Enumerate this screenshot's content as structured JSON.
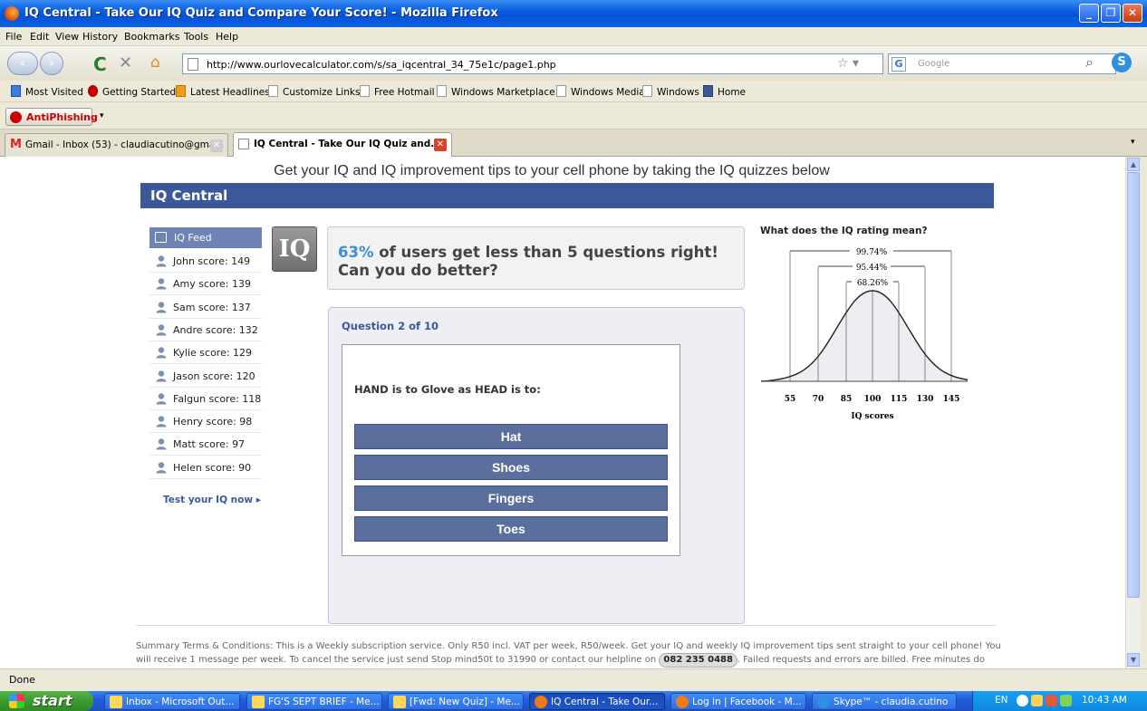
{
  "window": {
    "title": "IQ Central - Take Our IQ Quiz and Compare Your Score! - Mozilla Firefox"
  },
  "menu": [
    "File",
    "Edit",
    "View",
    "History",
    "Bookmarks",
    "Tools",
    "Help"
  ],
  "nav": {
    "url": "http://www.ourlovecalculator.com/s/sa_iqcentral_34_75e1c/page1.php",
    "search_placeholder": "Google"
  },
  "bookmarks": [
    "Most Visited",
    "Getting Started",
    "Latest Headlines",
    "Customize Links",
    "Free Hotmail",
    "Windows Marketplace",
    "Windows Media",
    "Windows",
    "Home"
  ],
  "antiphishing": {
    "label": "AntiPhishing"
  },
  "tabs": [
    {
      "label": "Gmail - Inbox (53) - claudiacutino@gma..."
    },
    {
      "label": "IQ Central - Take Our IQ Quiz and..."
    }
  ],
  "page": {
    "promo": "Get your IQ and IQ improvement tips to your cell phone by taking the IQ quizzes below",
    "header": "IQ Central",
    "feed_title": "IQ Feed",
    "users": [
      {
        "name": "John",
        "score": "score: 149"
      },
      {
        "name": "Amy",
        "score": "score: 139"
      },
      {
        "name": "Sam",
        "score": "score: 137"
      },
      {
        "name": "Andre",
        "score": "score: 132"
      },
      {
        "name": "Kylie",
        "score": "score: 129"
      },
      {
        "name": "Jason",
        "score": "score: 120"
      },
      {
        "name": "Falgun",
        "score": "score: 118"
      },
      {
        "name": "Henry",
        "score": "score: 98"
      },
      {
        "name": "Matt",
        "score": "score: 97"
      },
      {
        "name": "Helen",
        "score": "score: 90"
      }
    ],
    "test_now": "Test your IQ now ▸",
    "logo": "IQ",
    "stat_pct": "63%",
    "stat_text": " of users get less than 5 questions right! Can you do better?",
    "question_num": "Question 2 of 10",
    "question": "HAND is to Glove as HEAD is to:",
    "answers": [
      "Hat",
      "Shoes",
      "Fingers",
      "Toes"
    ],
    "curve": {
      "title": "What does the IQ rating mean?",
      "bands": [
        "99.74%",
        "95.44%",
        "68.26%"
      ],
      "ticks": [
        "55",
        "70",
        "85",
        "100",
        "115",
        "130",
        "145"
      ],
      "xlabel": "IQ scores"
    },
    "terms": "Summary Terms & Conditions: This is a Weekly subscription service. Only R50 incl. VAT per week, R50/week. Get your IQ and weekly IQ improvement tips sent straight to your cell phone! You will receive 1 message per week. To cancel the service just send Stop mind50t to 31990 or contact our helpline on",
    "helpline": "082 235 0488",
    "terms2": ". Failed requests and errors are billed. Free minutes do not apply."
  },
  "status": "Done",
  "taskbar": {
    "start": "start",
    "tasks": [
      "Inbox - Microsoft Out...",
      "FG'S SEPT BRIEF - Me...",
      "[Fwd: New Quiz] - Me...",
      "IQ Central - Take Our...",
      "Log in | Facebook - M...",
      "Skype™ - claudia.cutino"
    ],
    "lang": "EN",
    "clock": "10:43 AM"
  }
}
